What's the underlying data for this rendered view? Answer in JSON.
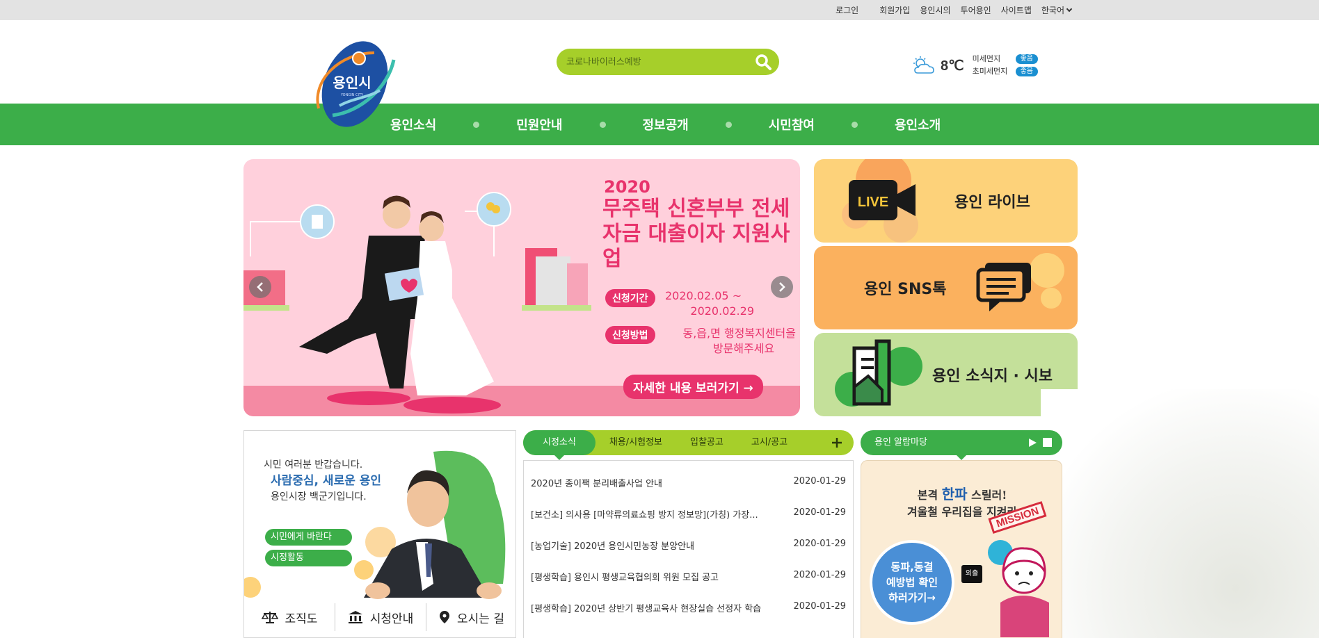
{
  "topbar": {
    "login": "로그인",
    "signup": "회원가입",
    "yonginsi": "용인시의",
    "tour": "투어용인",
    "sitemap": "사이트맵",
    "language": "한국어"
  },
  "logo": {
    "text": "용인시",
    "subtext": "YONGIN CITY"
  },
  "search": {
    "placeholder": "코로나바이러스예방"
  },
  "weather": {
    "temperature": "8℃",
    "fine_dust_label": "미세먼지",
    "fine_dust_status": "좋음",
    "ultrafine_dust_label": "초미세먼지",
    "ultrafine_dust_status": "좋음"
  },
  "nav": {
    "items": [
      "용인소식",
      "민원안내",
      "정보공개",
      "시민참여",
      "용인소개"
    ]
  },
  "banner": {
    "year": "2020",
    "headline": "무주택 신혼부부 전세자금 대출이자 지원사업",
    "period_label": "신청기간",
    "period_line1": "2020.02.05 ~",
    "period_line2": "2020.02.29",
    "method_label": "신청방법",
    "method_line1": "동,읍,면 행정복지센터을",
    "method_line2": "방문해주세요",
    "cta": "자세한 내용 보러가기 →",
    "live_text": "LIVE"
  },
  "tiles": {
    "live": "용인 라이브",
    "sns": "용인 SNS톡",
    "news": "용인 소식지 · 시보"
  },
  "mayor": {
    "greeting": "시민 여러분 반갑습니다.",
    "slogan": "사람중심, 새로운 용인",
    "name_line": "용인시장 백군기입니다.",
    "btn_wish": "시민에게 바란다",
    "btn_activity": "시정활동",
    "foot_org": "조직도",
    "foot_hall": "시청안내",
    "foot_way": "오시는 길"
  },
  "news": {
    "tabs": [
      "시정소식",
      "채용/시험정보",
      "입찰공고",
      "고시/공고"
    ],
    "items": [
      {
        "title": "2020년 종이팩 분리배출사업 안내",
        "date": "2020-01-29"
      },
      {
        "title": "[보건소] 의사용 [마약류의료쇼핑 방지 정보망](가칭) 가장...",
        "date": "2020-01-29"
      },
      {
        "title": "[농업기술] 2020년 용인시민농장 분양안내",
        "date": "2020-01-29"
      },
      {
        "title": "[평생학습] 용인시 평생교육협의회 위원 모집 공고",
        "date": "2020-01-29"
      },
      {
        "title": "[평생학습] 2020년 상반기 평생교육사 현장실습 선정자 학습",
        "date": "2020-01-29"
      }
    ]
  },
  "alarm": {
    "title": "용인 알람마당",
    "line1_pre": "본격",
    "line1_hl": "한파",
    "line1_post": "스릴러!",
    "line2": "겨울철 우리집을 지켜라",
    "stamp": "MISSION",
    "circle_l1": "동파,동결",
    "circle_l2": "예방법 확인",
    "circle_l3": "하러가기→",
    "tag": "외출"
  },
  "colors": {
    "nav_green": "#3cae49",
    "lime": "#a6cf2a",
    "banner_pink": "#ffd0dc",
    "accent_pink": "#e8336c",
    "tile_live": "#fdd27a",
    "tile_sns": "#fbb15e",
    "tile_news": "#c4e09a"
  }
}
